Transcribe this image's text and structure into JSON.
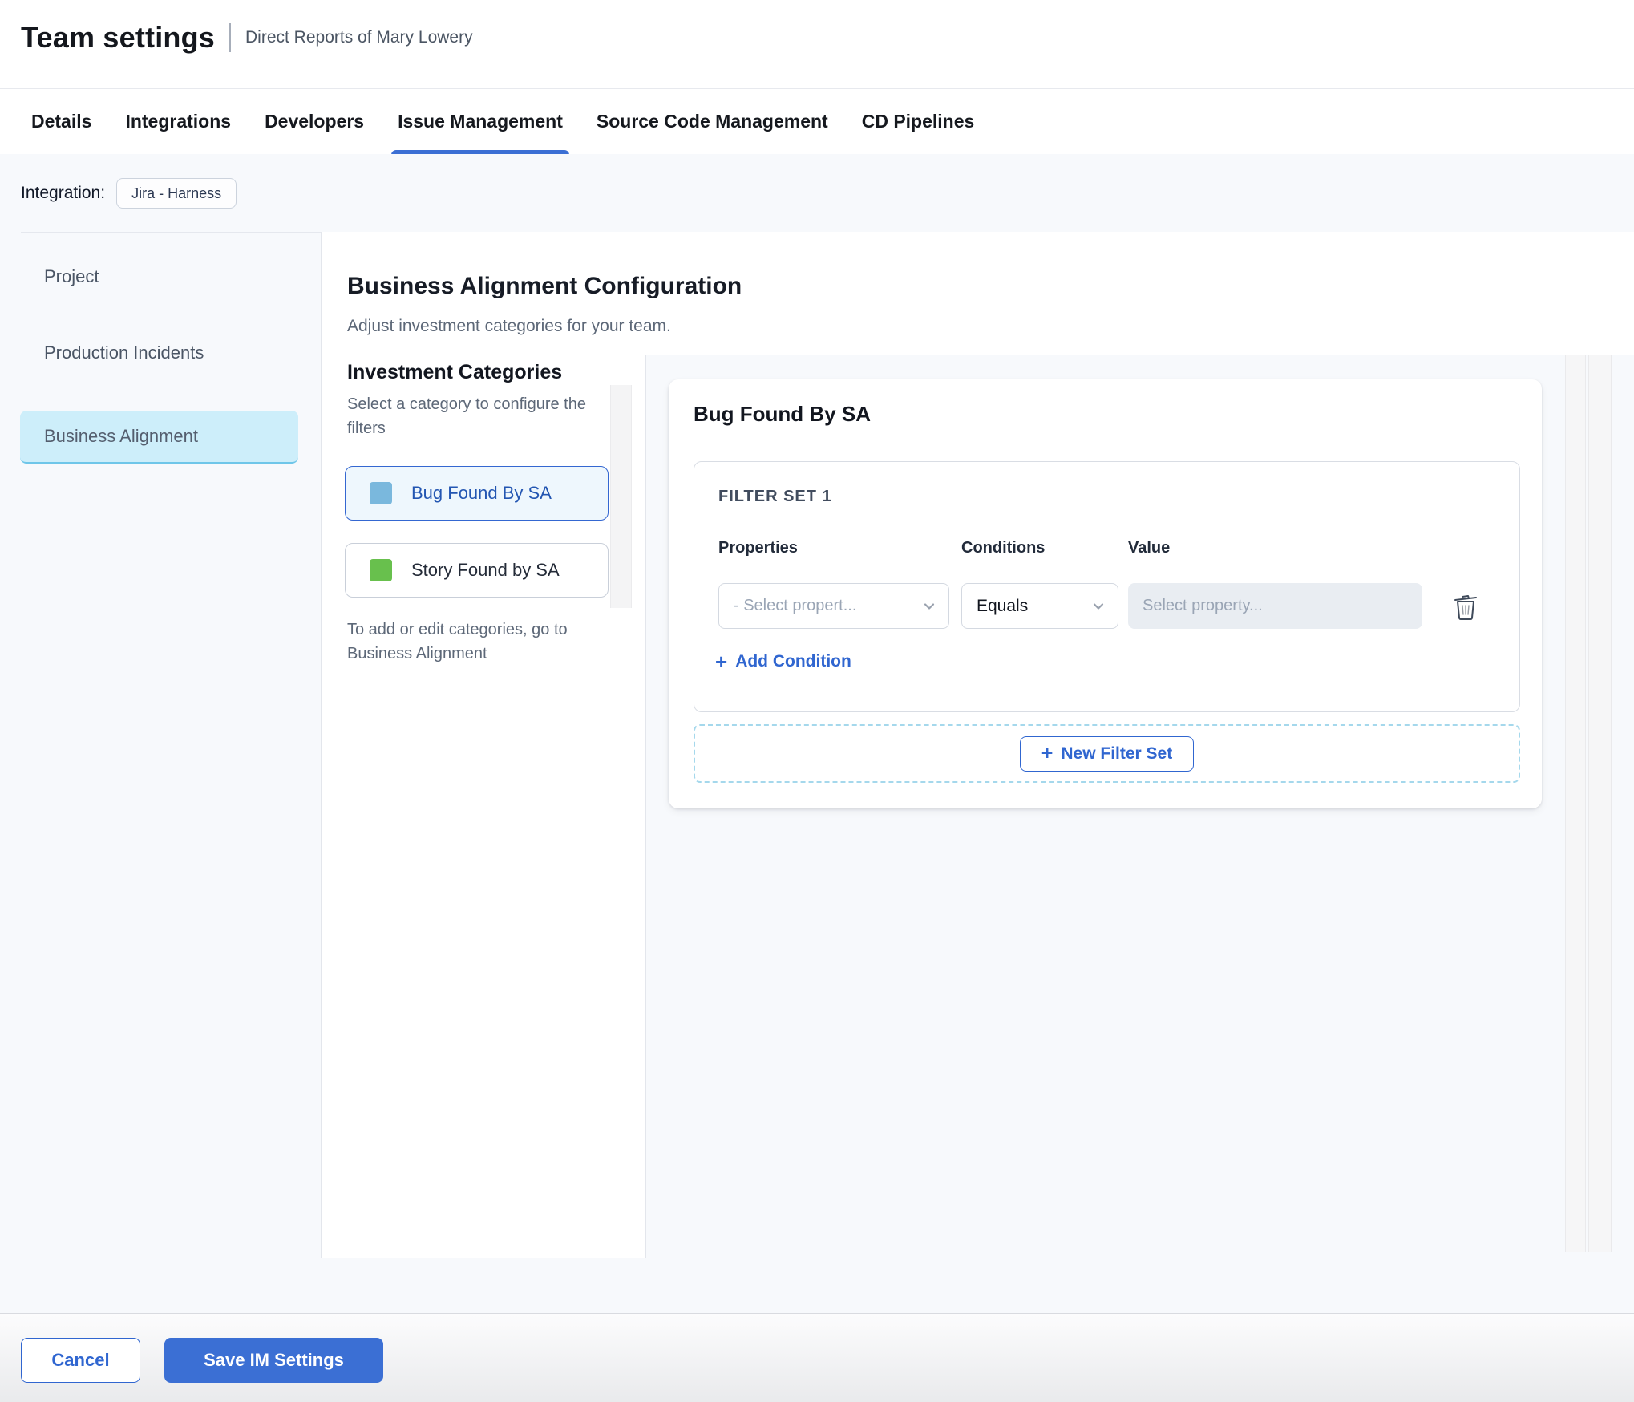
{
  "header": {
    "title": "Team settings",
    "subtitle": "Direct Reports of Mary Lowery"
  },
  "tabs": [
    {
      "label": "Details",
      "active": false
    },
    {
      "label": "Integrations",
      "active": false
    },
    {
      "label": "Developers",
      "active": false
    },
    {
      "label": "Issue Management",
      "active": true
    },
    {
      "label": "Source Code Management",
      "active": false
    },
    {
      "label": "CD Pipelines",
      "active": false
    }
  ],
  "integration": {
    "label": "Integration:",
    "chip": "Jira - Harness"
  },
  "sidebar": {
    "items": [
      {
        "label": "Project",
        "selected": false
      },
      {
        "label": "Production Incidents",
        "selected": false
      },
      {
        "label": "Business Alignment",
        "selected": true
      }
    ]
  },
  "main": {
    "title": "Business Alignment Configuration",
    "subtitle": "Adjust investment categories for your team.",
    "categories_panel": {
      "title": "Investment Categories",
      "subtitle": "Select a category to configure the filters",
      "items": [
        {
          "label": "Bug Found By SA",
          "swatch_color": "#7ab8dd",
          "selected": true
        },
        {
          "label": "Story Found by SA",
          "swatch_color": "#68c04d",
          "selected": false
        }
      ],
      "note": "To add or edit categories, go to Business Alignment"
    },
    "filter_panel": {
      "title": "Bug Found By SA",
      "filter_set": {
        "title": "FILTER SET 1",
        "columns": [
          "Properties",
          "Conditions",
          "Value"
        ],
        "row": {
          "properties_placeholder": "- Select propert...",
          "condition_value": "Equals",
          "value_placeholder": "Select property..."
        },
        "add_condition_label": "Add Condition"
      },
      "new_filter_set_label": "New Filter Set"
    }
  },
  "footer": {
    "cancel_label": "Cancel",
    "save_label": "Save IM Settings"
  },
  "colors": {
    "accent_blue": "#3066d0",
    "tab_underline": "#3b6fd4",
    "save_button_bg": "#3b6fd4",
    "selected_nav_bg": "#cdeefa",
    "selected_category_bg": "#eef7fd",
    "selected_category_border": "#3467d1",
    "swatch_blue": "#7ab8dd",
    "swatch_green": "#68c04d",
    "dashed_border": "#a5d8ec",
    "value_input_bg": "#e9edf2"
  }
}
